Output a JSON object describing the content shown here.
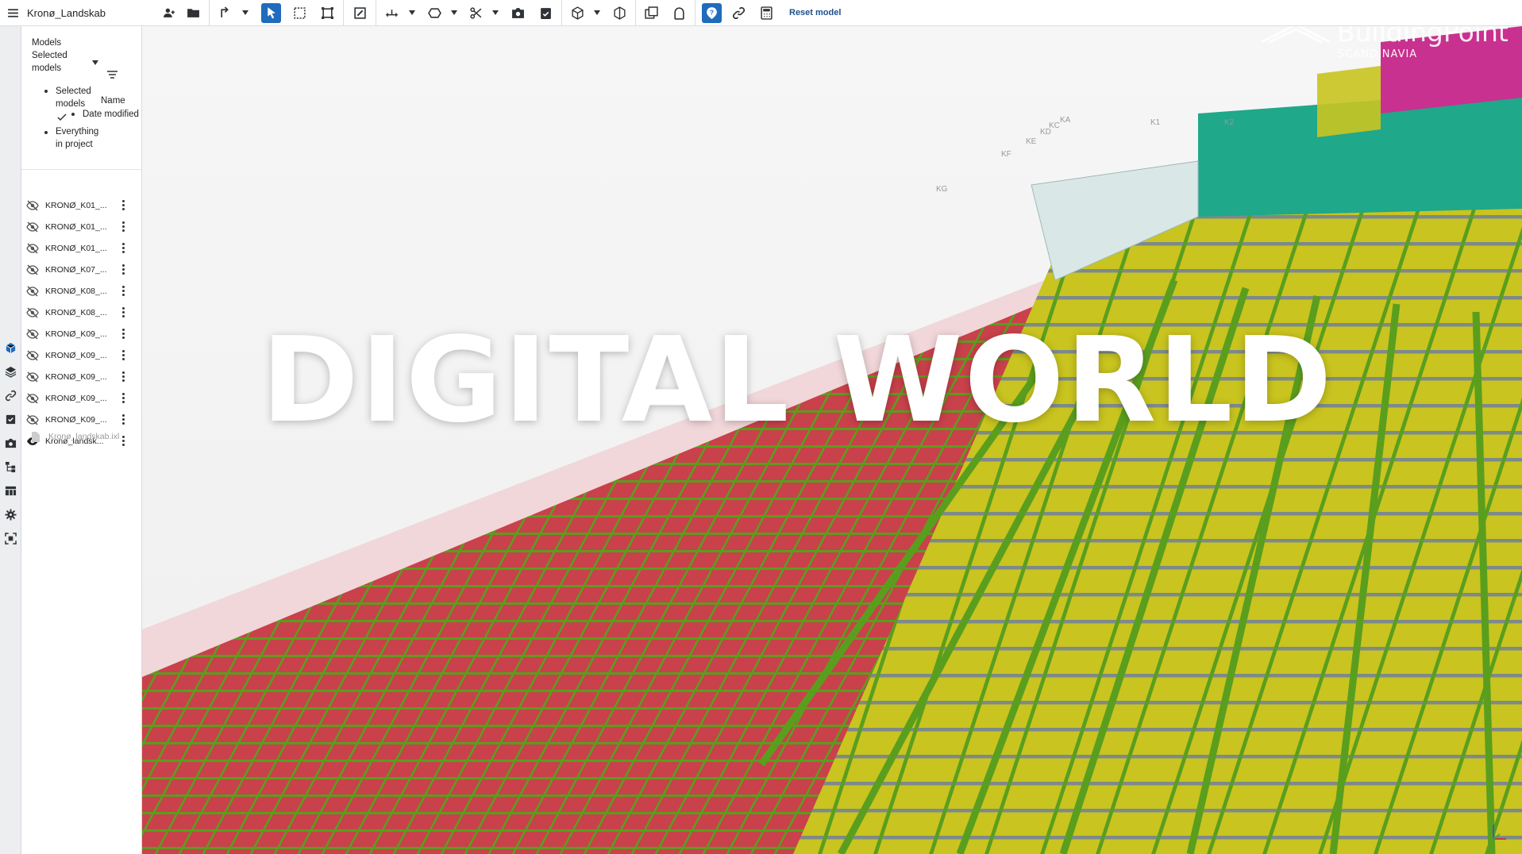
{
  "app": {
    "project_title": "Kronø_Landskab",
    "reset_model_label": "Reset model"
  },
  "panel": {
    "models_label": "Models",
    "filter_line1": "Selected",
    "filter_line2": "models",
    "options": {
      "selected_line1": "Selected",
      "selected_line2": "models",
      "everything_line1": "Everything",
      "everything_line2": "in project"
    },
    "sort": {
      "name": "Name",
      "date_modified": "Date modified"
    },
    "models": [
      {
        "name": "KRONØ_K01_...",
        "visible": false
      },
      {
        "name": "KRONØ_K01_...",
        "visible": false
      },
      {
        "name": "KRONØ_K01_...",
        "visible": false
      },
      {
        "name": "KRONØ_K07_...",
        "visible": false
      },
      {
        "name": "KRONØ_K08_...",
        "visible": false
      },
      {
        "name": "KRONØ_K08_...",
        "visible": false
      },
      {
        "name": "KRONØ_K09_...",
        "visible": false
      },
      {
        "name": "KRONØ_K09_...",
        "visible": false
      },
      {
        "name": "KRONØ_K09_...",
        "visible": false
      },
      {
        "name": "KRONØ_K09_...",
        "visible": false
      },
      {
        "name": "KRONØ_K09_...",
        "visible": false
      },
      {
        "name": "Kronø_landsk...",
        "visible": true
      }
    ],
    "file_name": "Kronø_landskab.ixl"
  },
  "viewport": {
    "overlay_title": "DIGITAL WORLD",
    "brand_name": "BuildingPoint",
    "brand_region": "SCANDINAVIA",
    "grid_labels": [
      "KG",
      "KF",
      "KE",
      "KD",
      "KC",
      "KA",
      "K1",
      "K2"
    ]
  },
  "colors": {
    "accent": "#1f6bbd",
    "rebar_green": "#5a9e1e",
    "slab_red": "#c9414b",
    "slab_yellow": "#c9c41f",
    "building_teal": "#1fa88a",
    "building_magenta": "#c8318f"
  }
}
